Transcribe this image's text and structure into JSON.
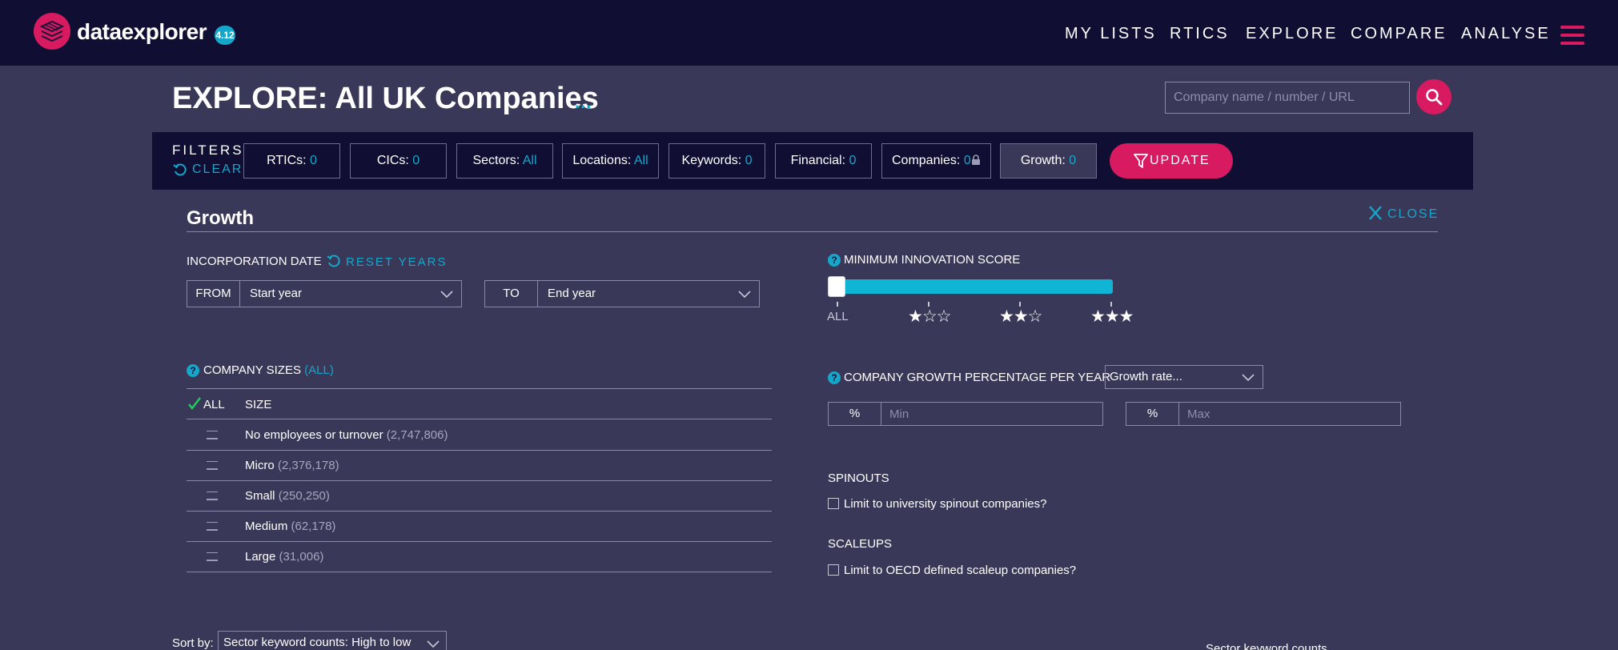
{
  "app": {
    "name": "dataexplorer",
    "version": "4.12"
  },
  "nav": {
    "items": [
      "MY LISTS",
      "RTICS",
      "EXPLORE",
      "COMPARE",
      "ANALYSE"
    ]
  },
  "page": {
    "title": "EXPLORE: All UK Companies",
    "options": "..."
  },
  "search": {
    "placeholder": "Company name / number / URL"
  },
  "filters": {
    "label": "FILTERS",
    "clear": "CLEAR",
    "chips": [
      {
        "label": "RTICs:",
        "value": "0"
      },
      {
        "label": "CICs:",
        "value": "0"
      },
      {
        "label": "Sectors:",
        "value": "All"
      },
      {
        "label": "Locations:",
        "value": "All"
      },
      {
        "label": "Keywords:",
        "value": "0"
      },
      {
        "label": "Financial:",
        "value": "0"
      },
      {
        "label": "Companies:",
        "value": "0"
      },
      {
        "label": "Growth:",
        "value": "0"
      }
    ],
    "update": "UPDATE"
  },
  "panel": {
    "title": "Growth",
    "close": "CLOSE",
    "incorporation": {
      "label": "INCORPORATION DATE",
      "reset": "RESET YEARS",
      "from_label": "FROM",
      "from_value": "Start year",
      "to_label": "TO",
      "to_value": "End year"
    },
    "innovation": {
      "label": "MINIMUM INNOVATION SCORE",
      "level": 0,
      "ticks": [
        {
          "label": "ALL",
          "stars": ""
        },
        {
          "label": "",
          "stars": "★☆☆"
        },
        {
          "label": "",
          "stars": "★★☆"
        },
        {
          "label": "",
          "stars": "★★★"
        }
      ]
    },
    "sizes": {
      "label": "COMPANY SIZES",
      "filter": "(ALL)",
      "col_all": "ALL",
      "col_size": "SIZE",
      "rows": [
        {
          "name": "No employees or turnover",
          "count": "(2,747,806)"
        },
        {
          "name": "Micro",
          "count": "(2,376,178)"
        },
        {
          "name": "Small",
          "count": "(250,250)"
        },
        {
          "name": "Medium",
          "count": "(62,178)"
        },
        {
          "name": "Large",
          "count": "(31,006)"
        }
      ]
    },
    "growth": {
      "label": "COMPANY GROWTH PERCENTAGE PER YEAR",
      "rate_select": "Growth rate...",
      "unit": "%",
      "min_placeholder": "Min",
      "max_placeholder": "Max"
    },
    "spinouts": {
      "label": "SPINOUTS",
      "option": "Limit to university spinout companies?"
    },
    "scaleups": {
      "label": "SCALEUPS",
      "option": "Limit to OECD defined scaleup companies?"
    }
  },
  "sort": {
    "label": "Sort by:",
    "value": "Sector keyword counts: High to low"
  },
  "results": {
    "column": "Sector keyword counts"
  },
  "colors": {
    "accent": "#d81b60",
    "link": "#16a6c9",
    "navy": "#100e33",
    "background": "#3a3858"
  },
  "icons": [
    "dataexplorer-logo-icon",
    "hamburger-icon",
    "search-icon",
    "refresh-icon",
    "lock-icon",
    "filter-icon",
    "close-icon",
    "help-icon",
    "chevron-down-icon",
    "check-icon",
    "star-icon"
  ]
}
